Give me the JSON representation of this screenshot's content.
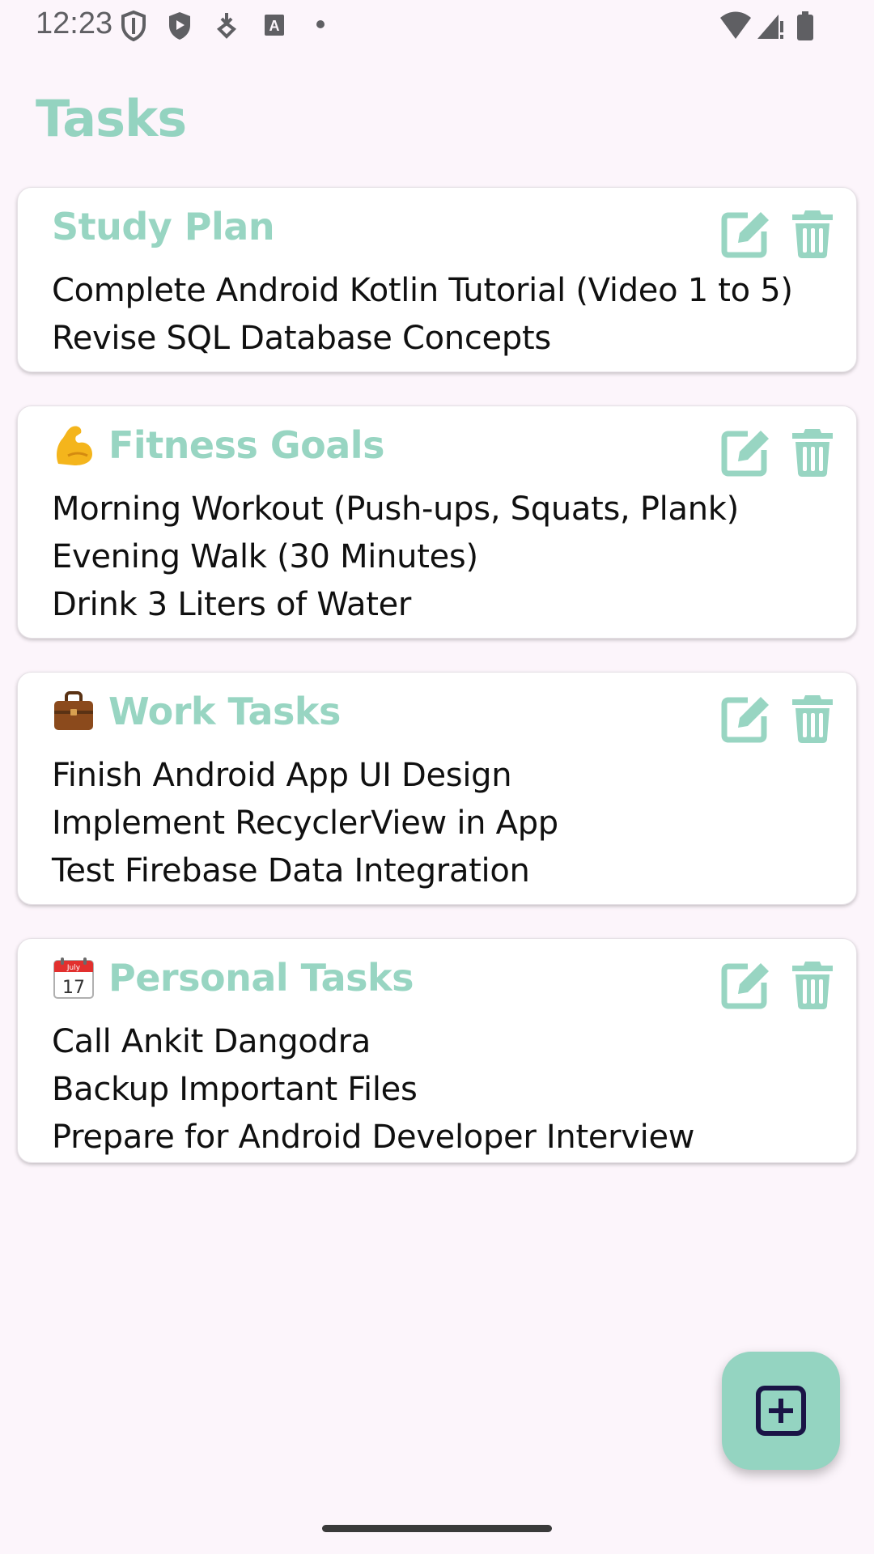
{
  "status_bar": {
    "time": "12:23",
    "left_icons": [
      "shield-outline-icon",
      "shield-play-icon",
      "download-icon",
      "text-icon",
      "dot-icon"
    ],
    "right_icons": [
      "wifi-icon",
      "signal-icon",
      "battery-icon"
    ]
  },
  "page": {
    "title": "Tasks"
  },
  "colors": {
    "accent": "#94d3c0",
    "background": "#fcf5fb",
    "card": "#ffffff",
    "fab_icon": "#1a1446"
  },
  "cards": [
    {
      "emoji": "",
      "title": "Study Plan",
      "tasks": [
        "Complete Android Kotlin Tutorial (Video 1 to 5)",
        "Revise SQL Database Concepts"
      ]
    },
    {
      "emoji": "flexed-biceps-icon",
      "title": "Fitness Goals",
      "tasks": [
        "Morning Workout (Push-ups, Squats, Plank)",
        "Evening Walk (30 Minutes)",
        "Drink 3 Liters of Water"
      ]
    },
    {
      "emoji": "briefcase-icon",
      "title": "Work Tasks",
      "tasks": [
        "Finish Android App UI Design",
        "Implement RecyclerView in App",
        "Test Firebase Data Integration"
      ]
    },
    {
      "emoji": "calendar-icon",
      "title": "Personal Tasks",
      "calendar_month": "July",
      "calendar_day": "17",
      "tasks": [
        "Call Ankit Dangodra",
        "Backup Important Files",
        "Prepare for Android Developer Interview"
      ]
    }
  ],
  "fab": {
    "icon": "add-box-icon"
  }
}
